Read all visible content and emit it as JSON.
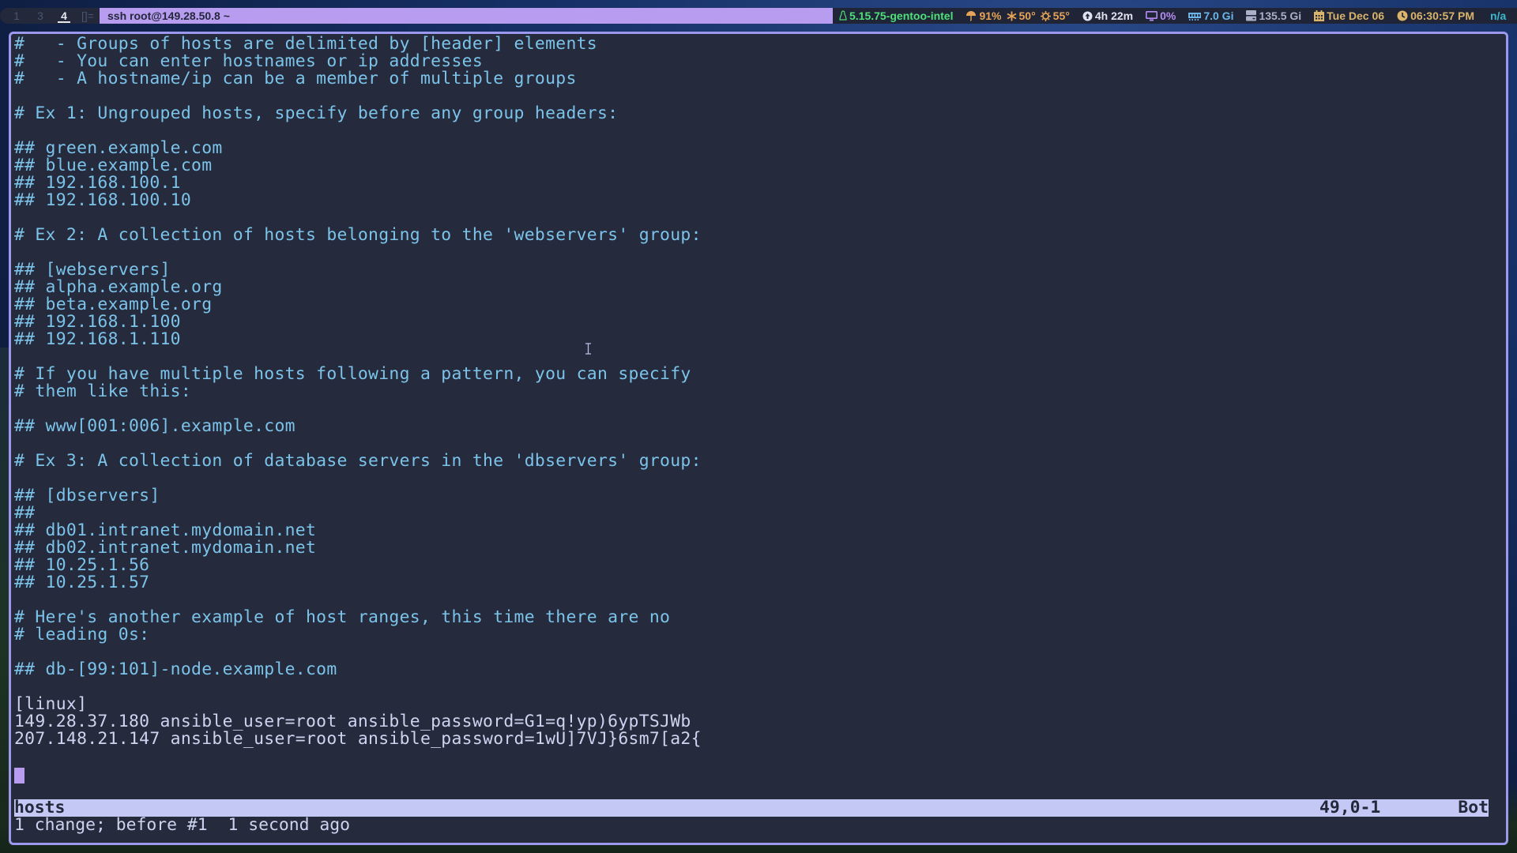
{
  "topbar": {
    "workspaces": [
      {
        "label": "1",
        "active": false
      },
      {
        "label": "3",
        "active": false
      },
      {
        "label": "4",
        "active": true
      }
    ],
    "layout_symbol": "[]=",
    "window_title": "ssh root@149.28.50.8 ~",
    "status": {
      "kernel": {
        "icon": "linux-penguin-icon",
        "text": "5.15.75-gentoo-intel",
        "color": "#4ee07a"
      },
      "weather": {
        "humidity": {
          "icon": "umbrella-icon",
          "text": "91%"
        },
        "low": {
          "icon": "snowflake-icon",
          "text": "50°"
        },
        "high": {
          "icon": "sun-icon",
          "text": "55°"
        },
        "color": "#e8a456"
      },
      "uptime": {
        "icon": "uptime-arrow-icon",
        "text": "4h 22m"
      },
      "cpu": {
        "icon": "monitor-icon",
        "text": "0%"
      },
      "memory": {
        "icon": "ram-icon",
        "text": "7.0 Gi"
      },
      "disk": {
        "icon": "disk-icon",
        "text": "135.5 Gi"
      },
      "date": {
        "icon": "calendar-icon",
        "text": "Tue Dec 06"
      },
      "time": {
        "icon": "clock-icon",
        "text": "06:30:57 PM"
      },
      "extra": {
        "text": "n/a"
      }
    }
  },
  "editor": {
    "lines": [
      {
        "text": "#   - Groups of hosts are delimited by [header] elements",
        "type": "comment"
      },
      {
        "text": "#   - You can enter hostnames or ip addresses",
        "type": "comment"
      },
      {
        "text": "#   - A hostname/ip can be a member of multiple groups",
        "type": "comment"
      },
      {
        "text": "",
        "type": "plain"
      },
      {
        "text": "# Ex 1: Ungrouped hosts, specify before any group headers:",
        "type": "comment"
      },
      {
        "text": "",
        "type": "plain"
      },
      {
        "text": "## green.example.com",
        "type": "comment"
      },
      {
        "text": "## blue.example.com",
        "type": "comment"
      },
      {
        "text": "## 192.168.100.1",
        "type": "comment"
      },
      {
        "text": "## 192.168.100.10",
        "type": "comment"
      },
      {
        "text": "",
        "type": "plain"
      },
      {
        "text": "# Ex 2: A collection of hosts belonging to the 'webservers' group:",
        "type": "comment"
      },
      {
        "text": "",
        "type": "plain"
      },
      {
        "text": "## [webservers]",
        "type": "comment"
      },
      {
        "text": "## alpha.example.org",
        "type": "comment"
      },
      {
        "text": "## beta.example.org",
        "type": "comment"
      },
      {
        "text": "## 192.168.1.100",
        "type": "comment"
      },
      {
        "text": "## 192.168.1.110",
        "type": "comment"
      },
      {
        "text": "",
        "type": "plain"
      },
      {
        "text": "# If you have multiple hosts following a pattern, you can specify",
        "type": "comment"
      },
      {
        "text": "# them like this:",
        "type": "comment"
      },
      {
        "text": "",
        "type": "plain"
      },
      {
        "text": "## www[001:006].example.com",
        "type": "comment"
      },
      {
        "text": "",
        "type": "plain"
      },
      {
        "text": "# Ex 3: A collection of database servers in the 'dbservers' group:",
        "type": "comment"
      },
      {
        "text": "",
        "type": "plain"
      },
      {
        "text": "## [dbservers]",
        "type": "comment"
      },
      {
        "text": "##",
        "type": "comment"
      },
      {
        "text": "## db01.intranet.mydomain.net",
        "type": "comment"
      },
      {
        "text": "## db02.intranet.mydomain.net",
        "type": "comment"
      },
      {
        "text": "## 10.25.1.56",
        "type": "comment"
      },
      {
        "text": "## 10.25.1.57",
        "type": "comment"
      },
      {
        "text": "",
        "type": "plain"
      },
      {
        "text": "# Here's another example of host ranges, this time there are no",
        "type": "comment"
      },
      {
        "text": "# leading 0s:",
        "type": "comment"
      },
      {
        "text": "",
        "type": "plain"
      },
      {
        "text": "## db-[99:101]-node.example.com",
        "type": "comment"
      },
      {
        "text": "",
        "type": "plain"
      },
      {
        "text": "[linux]",
        "type": "plain"
      },
      {
        "text": "149.28.37.180 ansible_user=root ansible_password=G1=q!yp)6ypTSJWb",
        "type": "plain"
      },
      {
        "text": "207.148.21.147 ansible_user=root ansible_password=1wU]7VJ}6sm7[a2{",
        "type": "plain"
      },
      {
        "text": "",
        "type": "plain"
      },
      {
        "text": "",
        "type": "cursor"
      }
    ],
    "statusline": {
      "filename": "hosts",
      "position": "49,0-1",
      "scroll": "Bot"
    },
    "message": "1 change; before #1  1 second ago"
  },
  "colors": {
    "comment": "#7cc3ea",
    "text": "#cdd4f0",
    "background": "#252a3c",
    "border": "#9c98ee",
    "accent": "#b79cf0",
    "statusline_bg": "#c3c9f4"
  }
}
